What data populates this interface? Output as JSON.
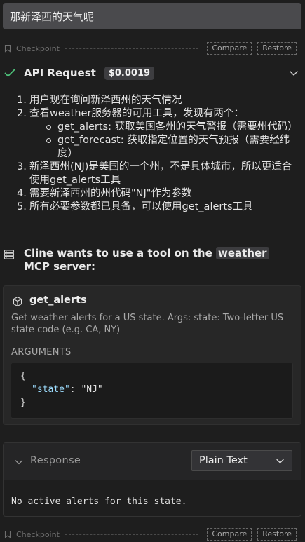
{
  "user_message": "那新泽西的天气呢",
  "checkpoint": {
    "label": "Checkpoint",
    "compare_label": "Compare",
    "restore_label": "Restore"
  },
  "api_request": {
    "title": "API Request",
    "cost": "$0.0019",
    "status_icon": "check-icon"
  },
  "steps": [
    "用户现在询问新泽西州的天气情况",
    "查看weather服务器的可用工具，发现有两个：",
    "新泽西州(NJ)是美国的一个州，不是具体城市，所以更适合使用get_alerts工具",
    "需要新泽西州的州代码\"NJ\"作为参数",
    "所有必要参数都已具备，可以使用get_alerts工具"
  ],
  "step_numbers": [
    "1.",
    "2.",
    "3.",
    "4.",
    "5."
  ],
  "sub_items": [
    "get_alerts: 获取美国各州的天气警报（需要州代码）",
    "get_forecast: 获取指定位置的天气预报（需要经纬度）"
  ],
  "tool_use": {
    "prefix": "Cline wants to use a tool on the",
    "server": "weather",
    "suffix": "MCP server:"
  },
  "tool_card": {
    "name": "get_alerts",
    "description": "Get weather alerts for a US state. Args: state: Two-letter US state code (e.g. CA, NY)",
    "arguments_label": "ARGUMENTS",
    "code": {
      "open": "{",
      "key": "\"state\"",
      "sep": ": ",
      "value": "\"NJ\"",
      "close": "}"
    }
  },
  "response": {
    "label": "Response",
    "format_selected": "Plain Text",
    "output": "No active alerts for this state."
  },
  "colors": {
    "background": "#1e1e1e",
    "user_bubble": "#4a4a4d",
    "check_green": "#4ec27a",
    "json_key": "#9cdcfe"
  }
}
